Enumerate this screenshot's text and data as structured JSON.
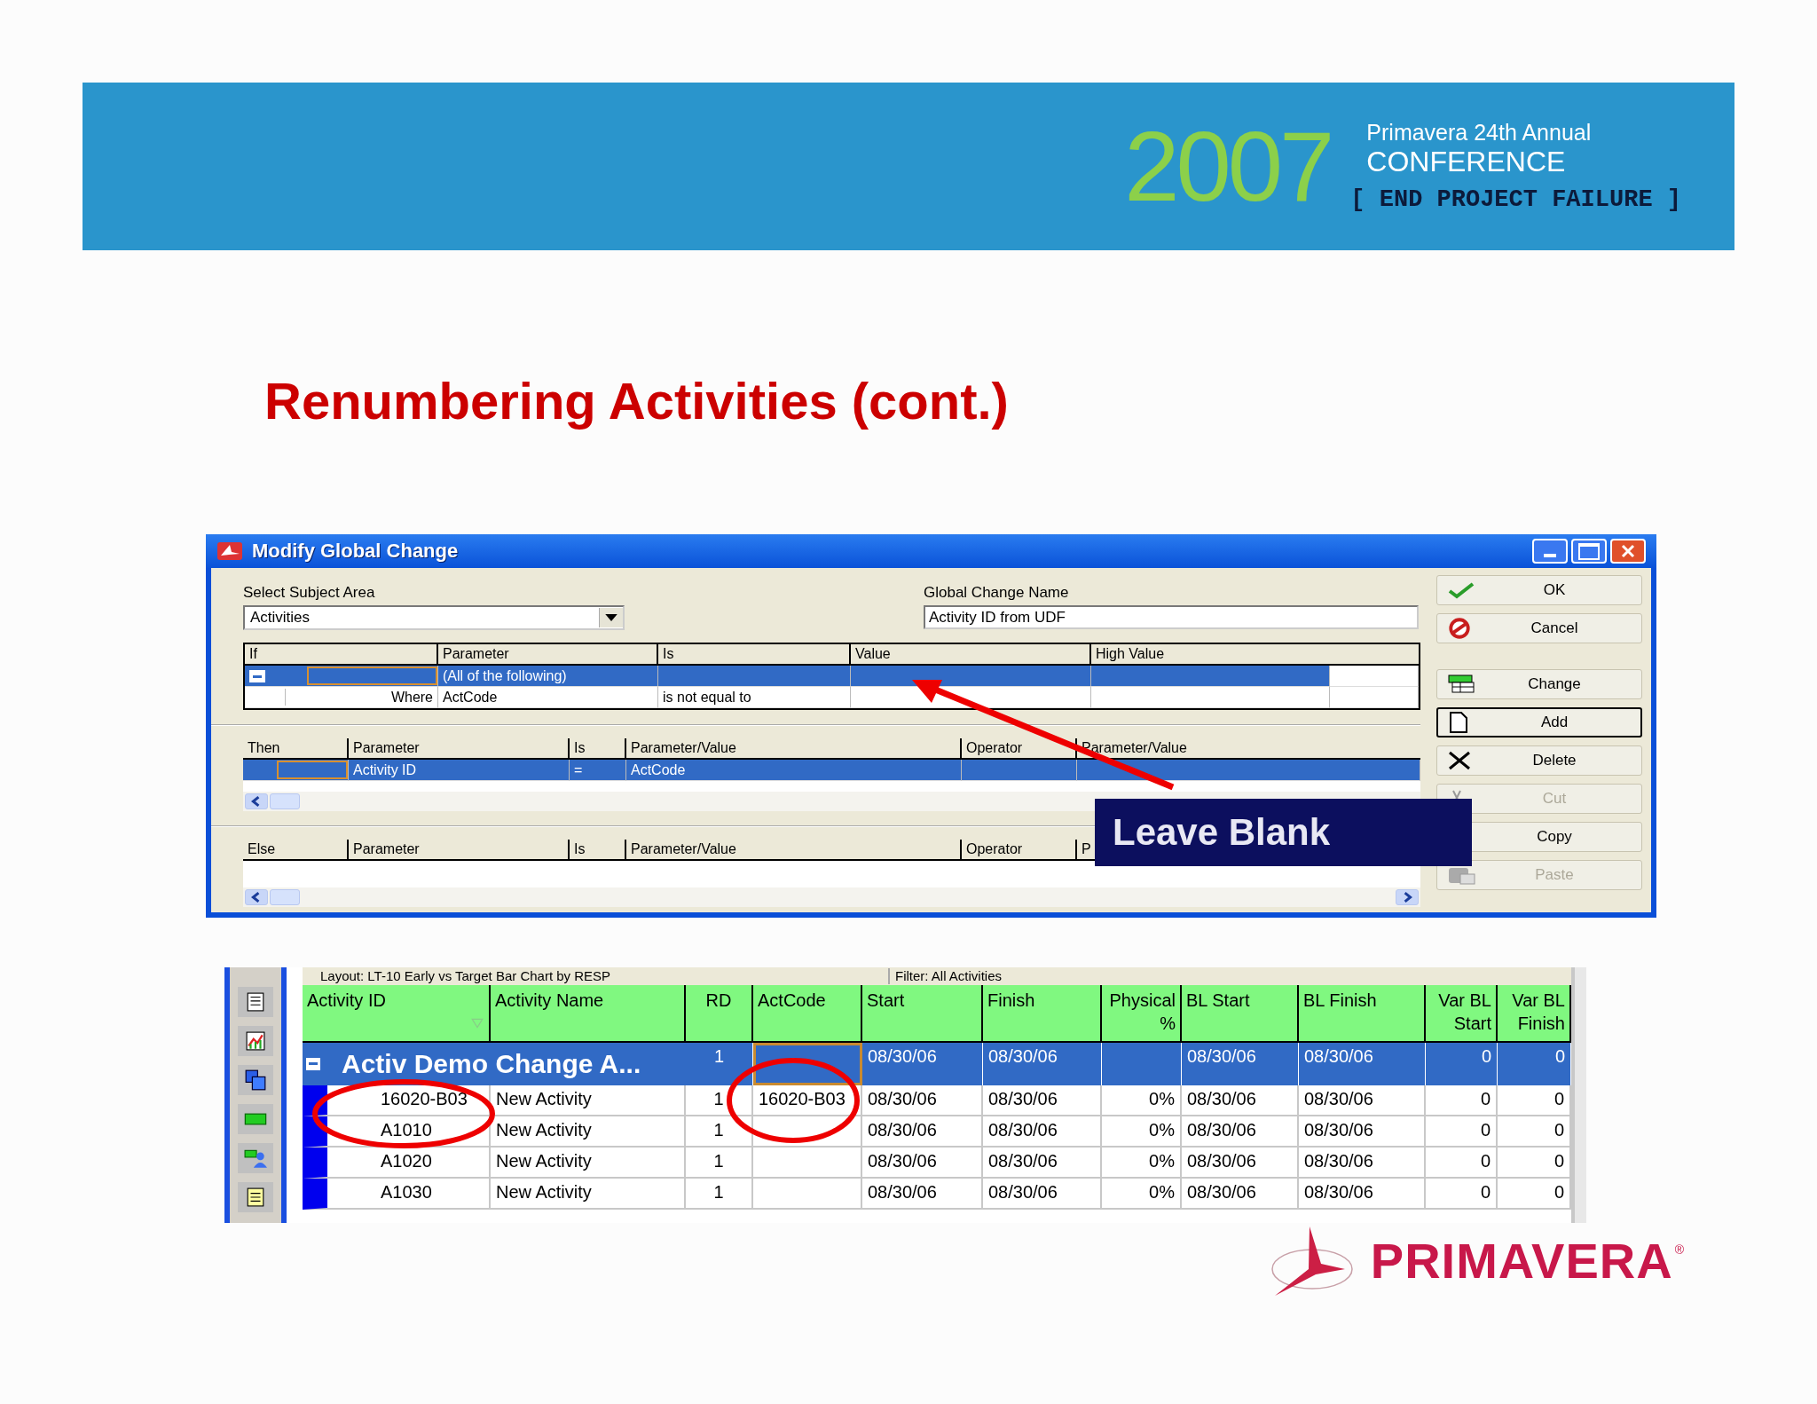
{
  "banner": {
    "year": "2007",
    "line_1": "Primavera 24th Annual",
    "line_2": "CONFERENCE",
    "tagline": "[ END PROJECT FAILURE ]"
  },
  "slide_title": "Renumbering Activities (cont.)",
  "dialog": {
    "title": "Modify Global Change",
    "subject_area": {
      "label": "Select Subject Area",
      "value": "Activities"
    },
    "change_name": {
      "label": "Global Change Name",
      "value": "Activity ID from UDF"
    },
    "if_grid": {
      "columns": [
        "If",
        "Parameter",
        "Is",
        "Value",
        "High Value"
      ],
      "rows": [
        {
          "expanded": true,
          "selected": true,
          "cells": [
            null,
            "(All of the following)",
            null,
            null,
            null
          ]
        },
        {
          "selected": false,
          "cells": [
            "Where",
            "ActCode",
            "is not equal to",
            null,
            null
          ]
        }
      ]
    },
    "then_grid": {
      "columns": [
        "Then",
        "Parameter",
        "Is",
        "Parameter/Value",
        "Operator",
        "Parameter/Value"
      ],
      "rows": [
        {
          "selected": true,
          "cells": [
            null,
            "Activity ID",
            "=",
            "ActCode",
            null,
            null
          ]
        }
      ]
    },
    "else_grid": {
      "columns": [
        "Else",
        "Parameter",
        "Is",
        "Parameter/Value",
        "Operator",
        "P"
      ]
    },
    "buttons": [
      {
        "label": "OK",
        "kind": "check",
        "disabled": false,
        "default": false
      },
      {
        "label": "Cancel",
        "kind": "cancel",
        "disabled": false,
        "default": false
      },
      {
        "label": "Change",
        "kind": "change",
        "disabled": false,
        "default": false
      },
      {
        "label": "Add",
        "kind": "add",
        "disabled": false,
        "default": true
      },
      {
        "label": "Delete",
        "kind": "delete",
        "disabled": false,
        "default": false
      },
      {
        "label": "Cut",
        "kind": "cut",
        "disabled": true,
        "default": false
      },
      {
        "label": "Copy",
        "kind": "copy",
        "disabled": false,
        "default": false
      },
      {
        "label": "Paste",
        "kind": "paste",
        "disabled": true,
        "default": false
      }
    ],
    "callout": "Leave Blank"
  },
  "activity_table": {
    "layout": "Layout: LT-10 Early vs Target Bar Chart by RESP",
    "filter": "Filter: All Activities",
    "columns": [
      "Activity ID",
      "Activity Name",
      "RD",
      "ActCode",
      "Start",
      "Finish",
      "Physical %",
      "BL Start",
      "BL Finish",
      "Var BL Start",
      "Var BL Finish"
    ],
    "group": {
      "label": "Activ  Demo Change A...",
      "expanded": true,
      "cells": [
        "1",
        null,
        "08/30/06",
        "08/30/06",
        null,
        "08/30/06",
        "08/30/06",
        "0",
        "0"
      ]
    },
    "rows": [
      {
        "cells": [
          "16020-B03",
          "New Activity",
          "1",
          "16020-B03",
          "08/30/06",
          "08/30/06",
          "0%",
          "08/30/06",
          "08/30/06",
          "0",
          "0"
        ]
      },
      {
        "cells": [
          "A1010",
          "New Activity",
          "1",
          null,
          "08/30/06",
          "08/30/06",
          "0%",
          "08/30/06",
          "08/30/06",
          "0",
          "0"
        ]
      },
      {
        "cells": [
          "A1020",
          "New Activity",
          "1",
          null,
          "08/30/06",
          "08/30/06",
          "0%",
          "08/30/06",
          "08/30/06",
          "0",
          "0"
        ]
      },
      {
        "cells": [
          "A1030",
          "New Activity",
          "1",
          null,
          "08/30/06",
          "08/30/06",
          "0%",
          "08/30/06",
          "08/30/06",
          "0",
          "0"
        ]
      }
    ]
  },
  "logo": {
    "name": "PRIMAVERA",
    "mark": "®"
  }
}
